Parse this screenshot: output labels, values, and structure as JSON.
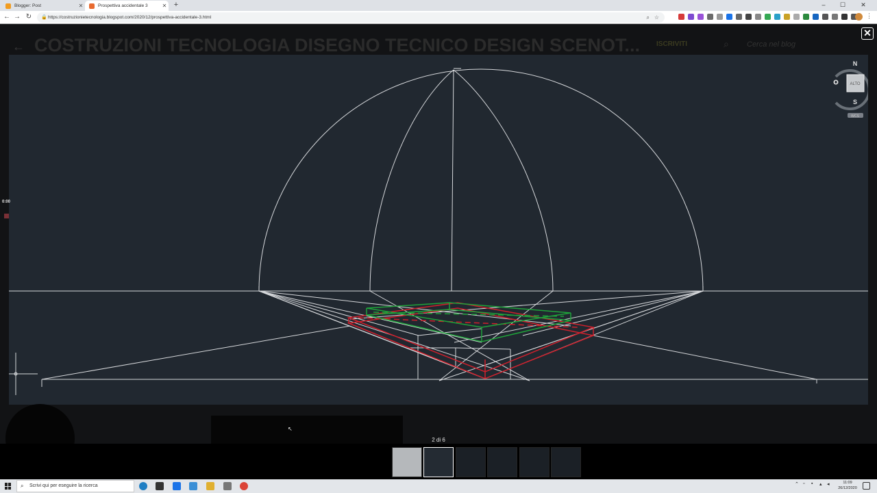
{
  "browser": {
    "tabs": [
      {
        "title": "Blogger: Post",
        "favicon_color": "#f29c1f"
      },
      {
        "title": "Prospettiva accidentale 3",
        "favicon_color": "#e86a2f"
      }
    ],
    "url": "https://costruzionietecnologia.blogspot.com/2020/12/prospettiva-accidentale-3.html"
  },
  "blog": {
    "title": "COSTRUZIONI TECNOLOGIA DISEGNO TECNICO DESIGN SCENOT...",
    "subscribe_label": "ISCRIVITI",
    "search_placeholder": "Cerca nel blog"
  },
  "viewer": {
    "viewcube": {
      "north": "N",
      "south": "S",
      "west": "O",
      "face": "ALTO",
      "ucs": "WCS"
    },
    "timecode": "0:00",
    "counter": "2 di 6",
    "thumbnail_count": 6,
    "selected_thumbnail": 2
  },
  "drawing_colors": {
    "lines": "#d8dadd",
    "red_box": "#d0202c",
    "green_box": "#1fa33a",
    "background": "#212830"
  },
  "taskbar": {
    "search_placeholder": "Scrivi qui per eseguire la ricerca",
    "time": "11:09",
    "date": "26/12/2020"
  }
}
